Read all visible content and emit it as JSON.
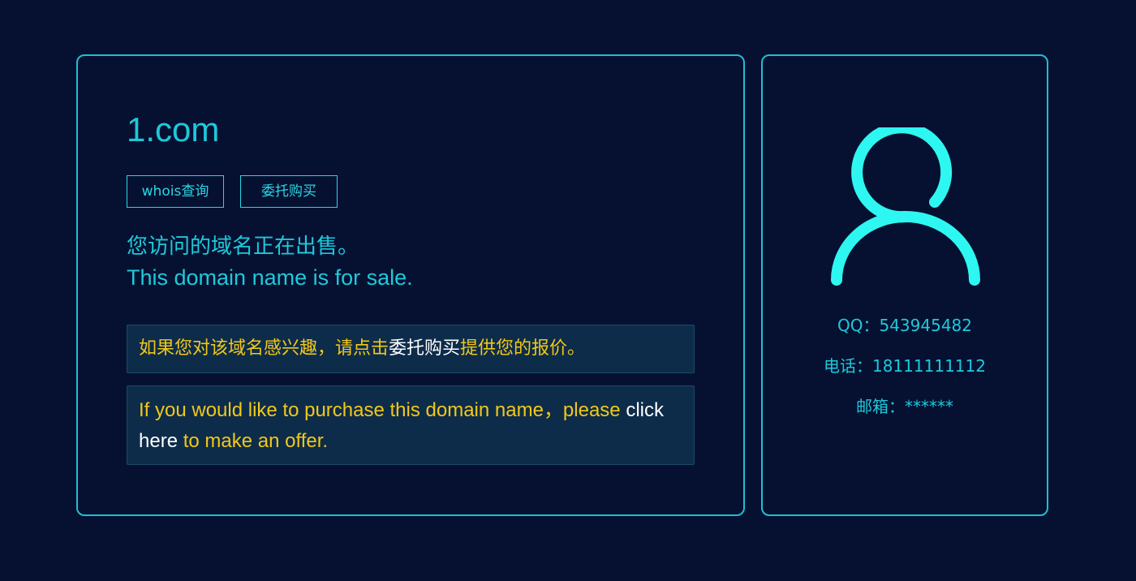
{
  "domain": {
    "name": "1.com"
  },
  "buttons": {
    "whois_label": "whois查询",
    "buy_label": "委托购买"
  },
  "sale": {
    "cn": "您访问的域名正在出售。",
    "en": "This domain name is for sale."
  },
  "offer_cn": {
    "prefix": "如果您对该域名感兴趣，请点击",
    "link": "委托购买",
    "suffix": "提供您的报价。"
  },
  "offer_en": {
    "prefix": "If you would like to purchase this domain name，please ",
    "link": "click here",
    "suffix": " to make an offer."
  },
  "contact": {
    "icon": "user-icon",
    "qq_label": "QQ：",
    "qq_value": "543945482",
    "phone_label": "电话：",
    "phone_value": "18111111112",
    "email_label": "邮箱：",
    "email_value": "******"
  },
  "colors": {
    "background": "#061132",
    "accent": "#1ec9d9",
    "icon": "#2ef7f2",
    "offer_text": "#f2c818",
    "offer_box": "#0d2c4a"
  }
}
